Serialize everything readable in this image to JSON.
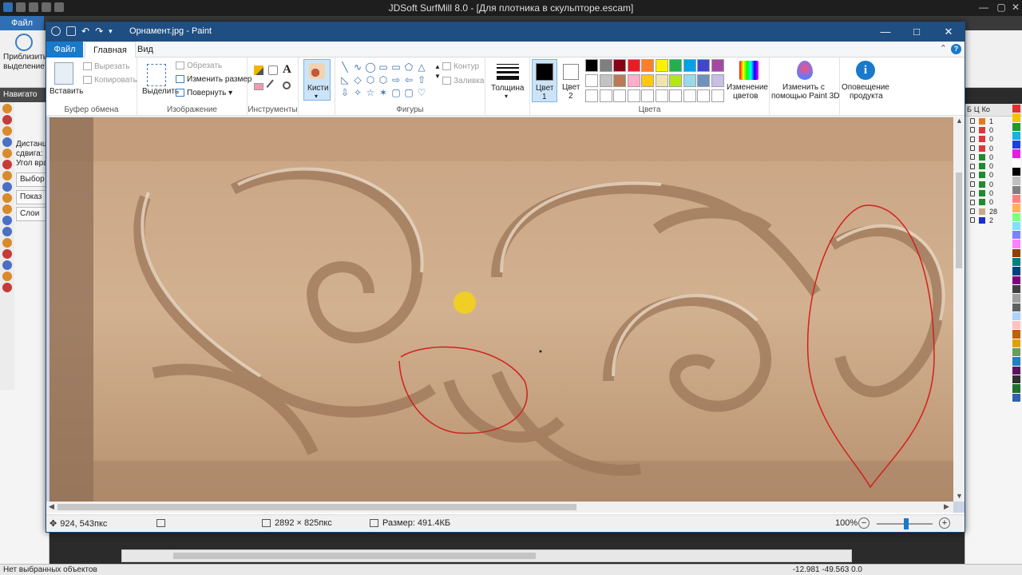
{
  "bg_app": {
    "title": "JDSoft SurfMill 8.0 - [Для плотника в скульпторе.escam]",
    "file_tab": "Файл",
    "zoom_button_line1": "Приблизить",
    "zoom_button_line2": "выделение",
    "navigator_title": "Навигато",
    "nav_text_1": "Дистанц",
    "nav_text_2": "сдвига:",
    "nav_text_3": "Угол вра",
    "nav_btn_select": "Выбор",
    "nav_btn_show": "Показ",
    "nav_btn_layers": "Слои",
    "right_head": [
      "Б",
      "Ц",
      "Ко"
    ],
    "layers": [
      {
        "color": "#e07b1f",
        "count": "1"
      },
      {
        "color": "#d93a3a",
        "count": "0"
      },
      {
        "color": "#d93a3a",
        "count": "0"
      },
      {
        "color": "#d93a3a",
        "count": "0"
      },
      {
        "color": "#1f8a2e",
        "count": "0"
      },
      {
        "color": "#1f8a2e",
        "count": "0"
      },
      {
        "color": "#1f8a2e",
        "count": "0"
      },
      {
        "color": "#1f8a2e",
        "count": "0"
      },
      {
        "color": "#1f8a2e",
        "count": "0"
      },
      {
        "color": "#1f8a2e",
        "count": "0"
      },
      {
        "color": "#c9a98a",
        "count": "28"
      },
      {
        "color": "#1a2fc9",
        "count": "2"
      }
    ],
    "palette": [
      "#e0302f",
      "#f2c400",
      "#1f9a2e",
      "#1ab0e0",
      "#2040d0",
      "#e020e0",
      "#ffffff",
      "#000000",
      "#c0c0c0",
      "#808080",
      "#ff8080",
      "#ffb060",
      "#80ff80",
      "#80e0ff",
      "#8080ff",
      "#ff80ff",
      "#904000",
      "#008080",
      "#004080",
      "#800080",
      "#404040",
      "#a0a0a0",
      "#606060",
      "#b0d0ff",
      "#ffc0c0",
      "#c06000",
      "#e0a000",
      "#60a060",
      "#2080c0",
      "#601060",
      "#303030",
      "#207030",
      "#3060b0"
    ],
    "status_text": "Нет выбранных объектов",
    "coords": "-12.981 -49.563 0.0"
  },
  "paint": {
    "title": "Орнамент.jpg - Paint",
    "tabs": {
      "file": "Файл",
      "home": "Главная",
      "view": "Вид"
    },
    "clipboard": {
      "paste": "Вставить",
      "cut": "Вырезать",
      "copy": "Копировать",
      "group": "Буфер обмена"
    },
    "image": {
      "select": "Выделить",
      "crop": "Обрезать",
      "resize": "Изменить размер",
      "rotate": "Повернуть",
      "group": "Изображение"
    },
    "tools": {
      "group": "Инструменты",
      "text_tool": "A"
    },
    "brushes": {
      "label": "Кисти"
    },
    "shapes": {
      "outline": "Контур",
      "fill": "Заливка",
      "group": "Фигуры"
    },
    "thickness": {
      "label": "Толщина"
    },
    "color1": {
      "line1": "Цвет",
      "line2": "1",
      "value": "#000000"
    },
    "color2": {
      "line1": "Цвет",
      "line2": "2",
      "value": "#ffffff"
    },
    "colors_group": "Цвета",
    "edit_colors": {
      "line1": "Изменение",
      "line2": "цветов"
    },
    "paint3d": {
      "line1": "Изменить с",
      "line2": "помощью Paint 3D"
    },
    "notifications": {
      "line1": "Оповещение",
      "line2": "продукта"
    },
    "palette_row1": [
      "#000000",
      "#7f7f7f",
      "#880015",
      "#ed1c24",
      "#ff7f27",
      "#fff200",
      "#22b14c",
      "#00a2e8",
      "#3f48cc",
      "#a349a4"
    ],
    "palette_row2": [
      "#ffffff",
      "#c3c3c3",
      "#b97a57",
      "#ffaec9",
      "#ffc90e",
      "#efe4b0",
      "#b5e61d",
      "#99d9ea",
      "#7092be",
      "#c8bfe7"
    ],
    "status": {
      "cursor": "924, 543пкс",
      "dimensions": "2892 × 825пкс",
      "size": "Размер: 491.4КБ",
      "zoom": "100%"
    }
  }
}
